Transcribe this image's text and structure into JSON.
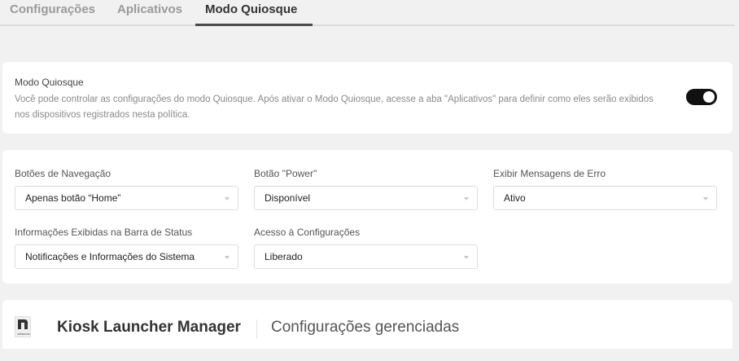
{
  "tabs": [
    {
      "label": "Configurações",
      "active": false
    },
    {
      "label": "Aplicativos",
      "active": false
    },
    {
      "label": "Modo Quiosque",
      "active": true
    }
  ],
  "kiosk": {
    "title": "Modo Quiosque",
    "description": "Você pode controlar as configurações do modo Quiosque. Após ativar o Modo Quiosque, acesse a aba \"Aplicativos\" para definir como eles serão exibidos nos dispositivos registrados nesta política.",
    "enabled": true
  },
  "settings": {
    "nav_buttons": {
      "label": "Botões de Navegação",
      "value": "Apenas botão “Home”"
    },
    "power_button": {
      "label": "Botão \"Power\"",
      "value": "Disponível"
    },
    "error_messages": {
      "label": "Exibir Mensagens de Erro",
      "value": "Ativo"
    },
    "status_bar": {
      "label": "Informações Exibidas na Barra de Status",
      "value": "Notificações e Informações do Sistema"
    },
    "settings_access": {
      "label": "Acesso à Configurações",
      "value": "Liberado"
    }
  },
  "launcher": {
    "logo_text": "datamob",
    "name": "Kiosk Launcher Manager",
    "subtitle": "Configurações gerenciadas"
  },
  "colors": {
    "toggle_on": "#111111",
    "active_tab_underline": "#4a4a4a"
  }
}
